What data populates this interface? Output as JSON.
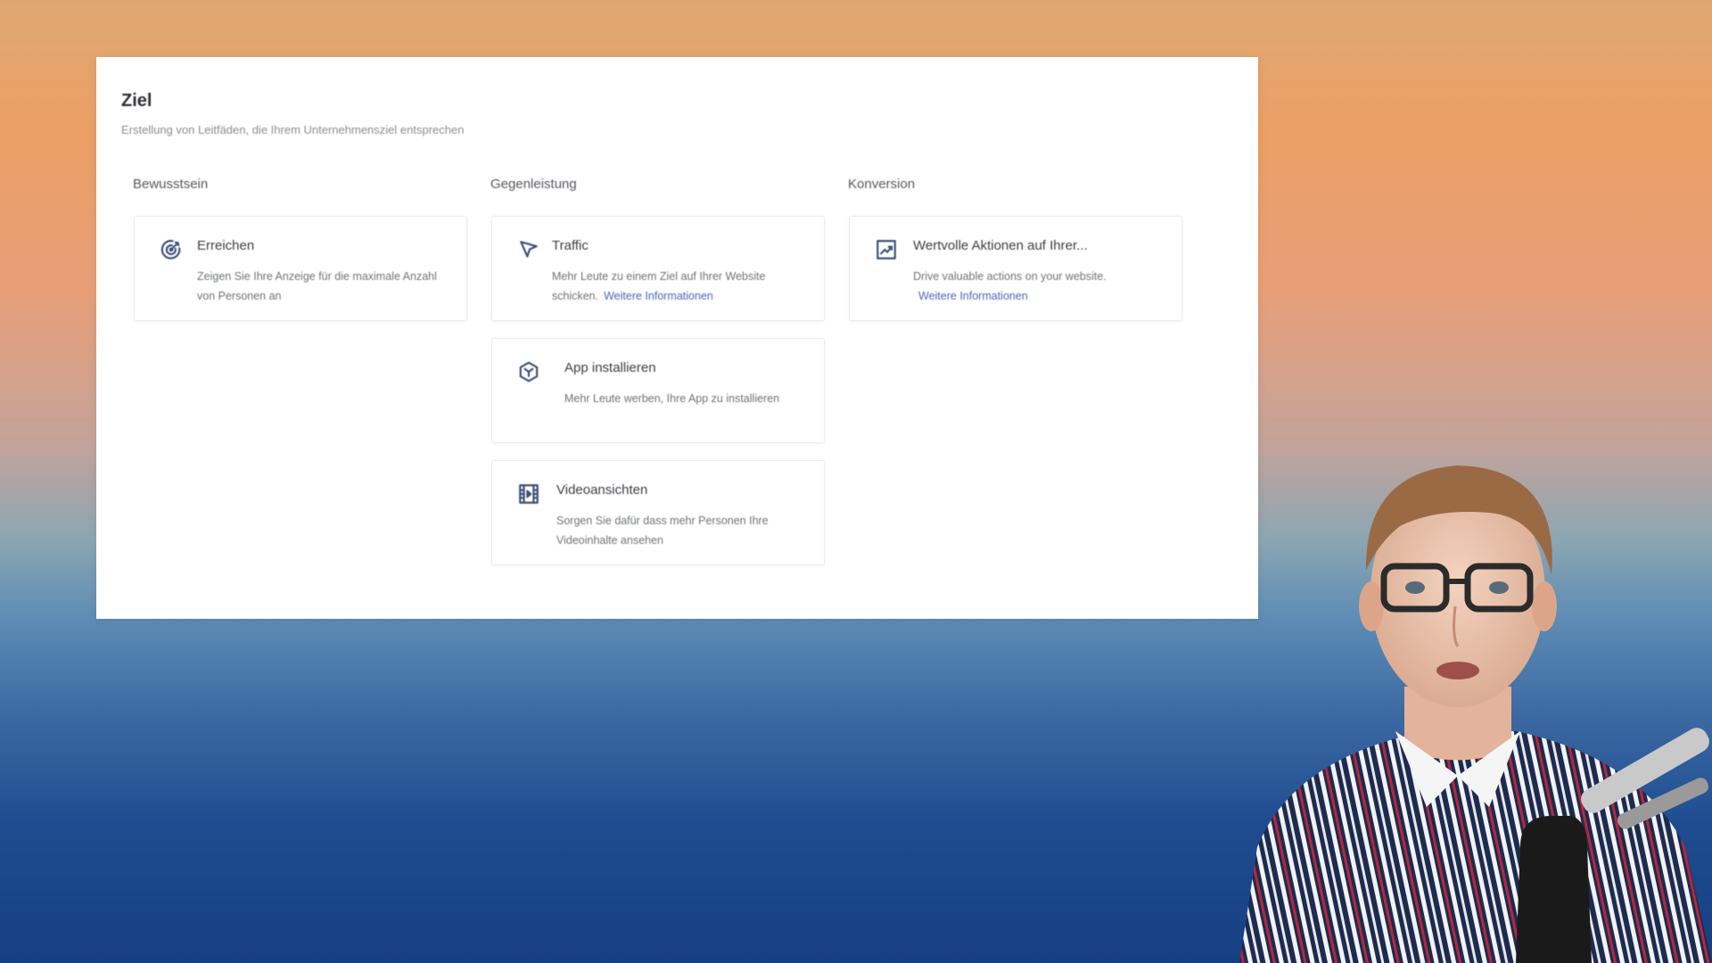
{
  "panel": {
    "title": "Ziel",
    "subtitle": "Erstellung von Leitfäden, die Ihrem Unternehmensziel entsprechen"
  },
  "columns": [
    {
      "heading": "Bewusstsein"
    },
    {
      "heading": "Gegenleistung"
    },
    {
      "heading": "Konversion"
    }
  ],
  "cards": {
    "reach": {
      "icon": "target-icon",
      "title": "Erreichen",
      "desc": "Zeigen Sie Ihre Anzeige für die maximale Anzahl von Personen an"
    },
    "traffic": {
      "icon": "cursor-icon",
      "title": "Traffic",
      "desc": "Mehr Leute zu einem Ziel auf Ihrer Website schicken.",
      "link": "Weitere Informationen"
    },
    "app_install": {
      "icon": "cube-icon",
      "title": "App installieren",
      "desc": "Mehr Leute werben, Ihre App zu installieren"
    },
    "video_views": {
      "icon": "film-icon",
      "title": "Videoansichten",
      "desc": "Sorgen Sie dafür dass mehr Personen Ihre Videoinhalte ansehen"
    },
    "conversions": {
      "icon": "chart-icon",
      "title": "Wertvolle Aktionen auf Ihrer...",
      "desc": "Drive valuable actions on your website.",
      "link": "Weitere Informationen"
    }
  },
  "colors": {
    "accent_link": "#4a66b8",
    "icon": "#3d4f78"
  }
}
